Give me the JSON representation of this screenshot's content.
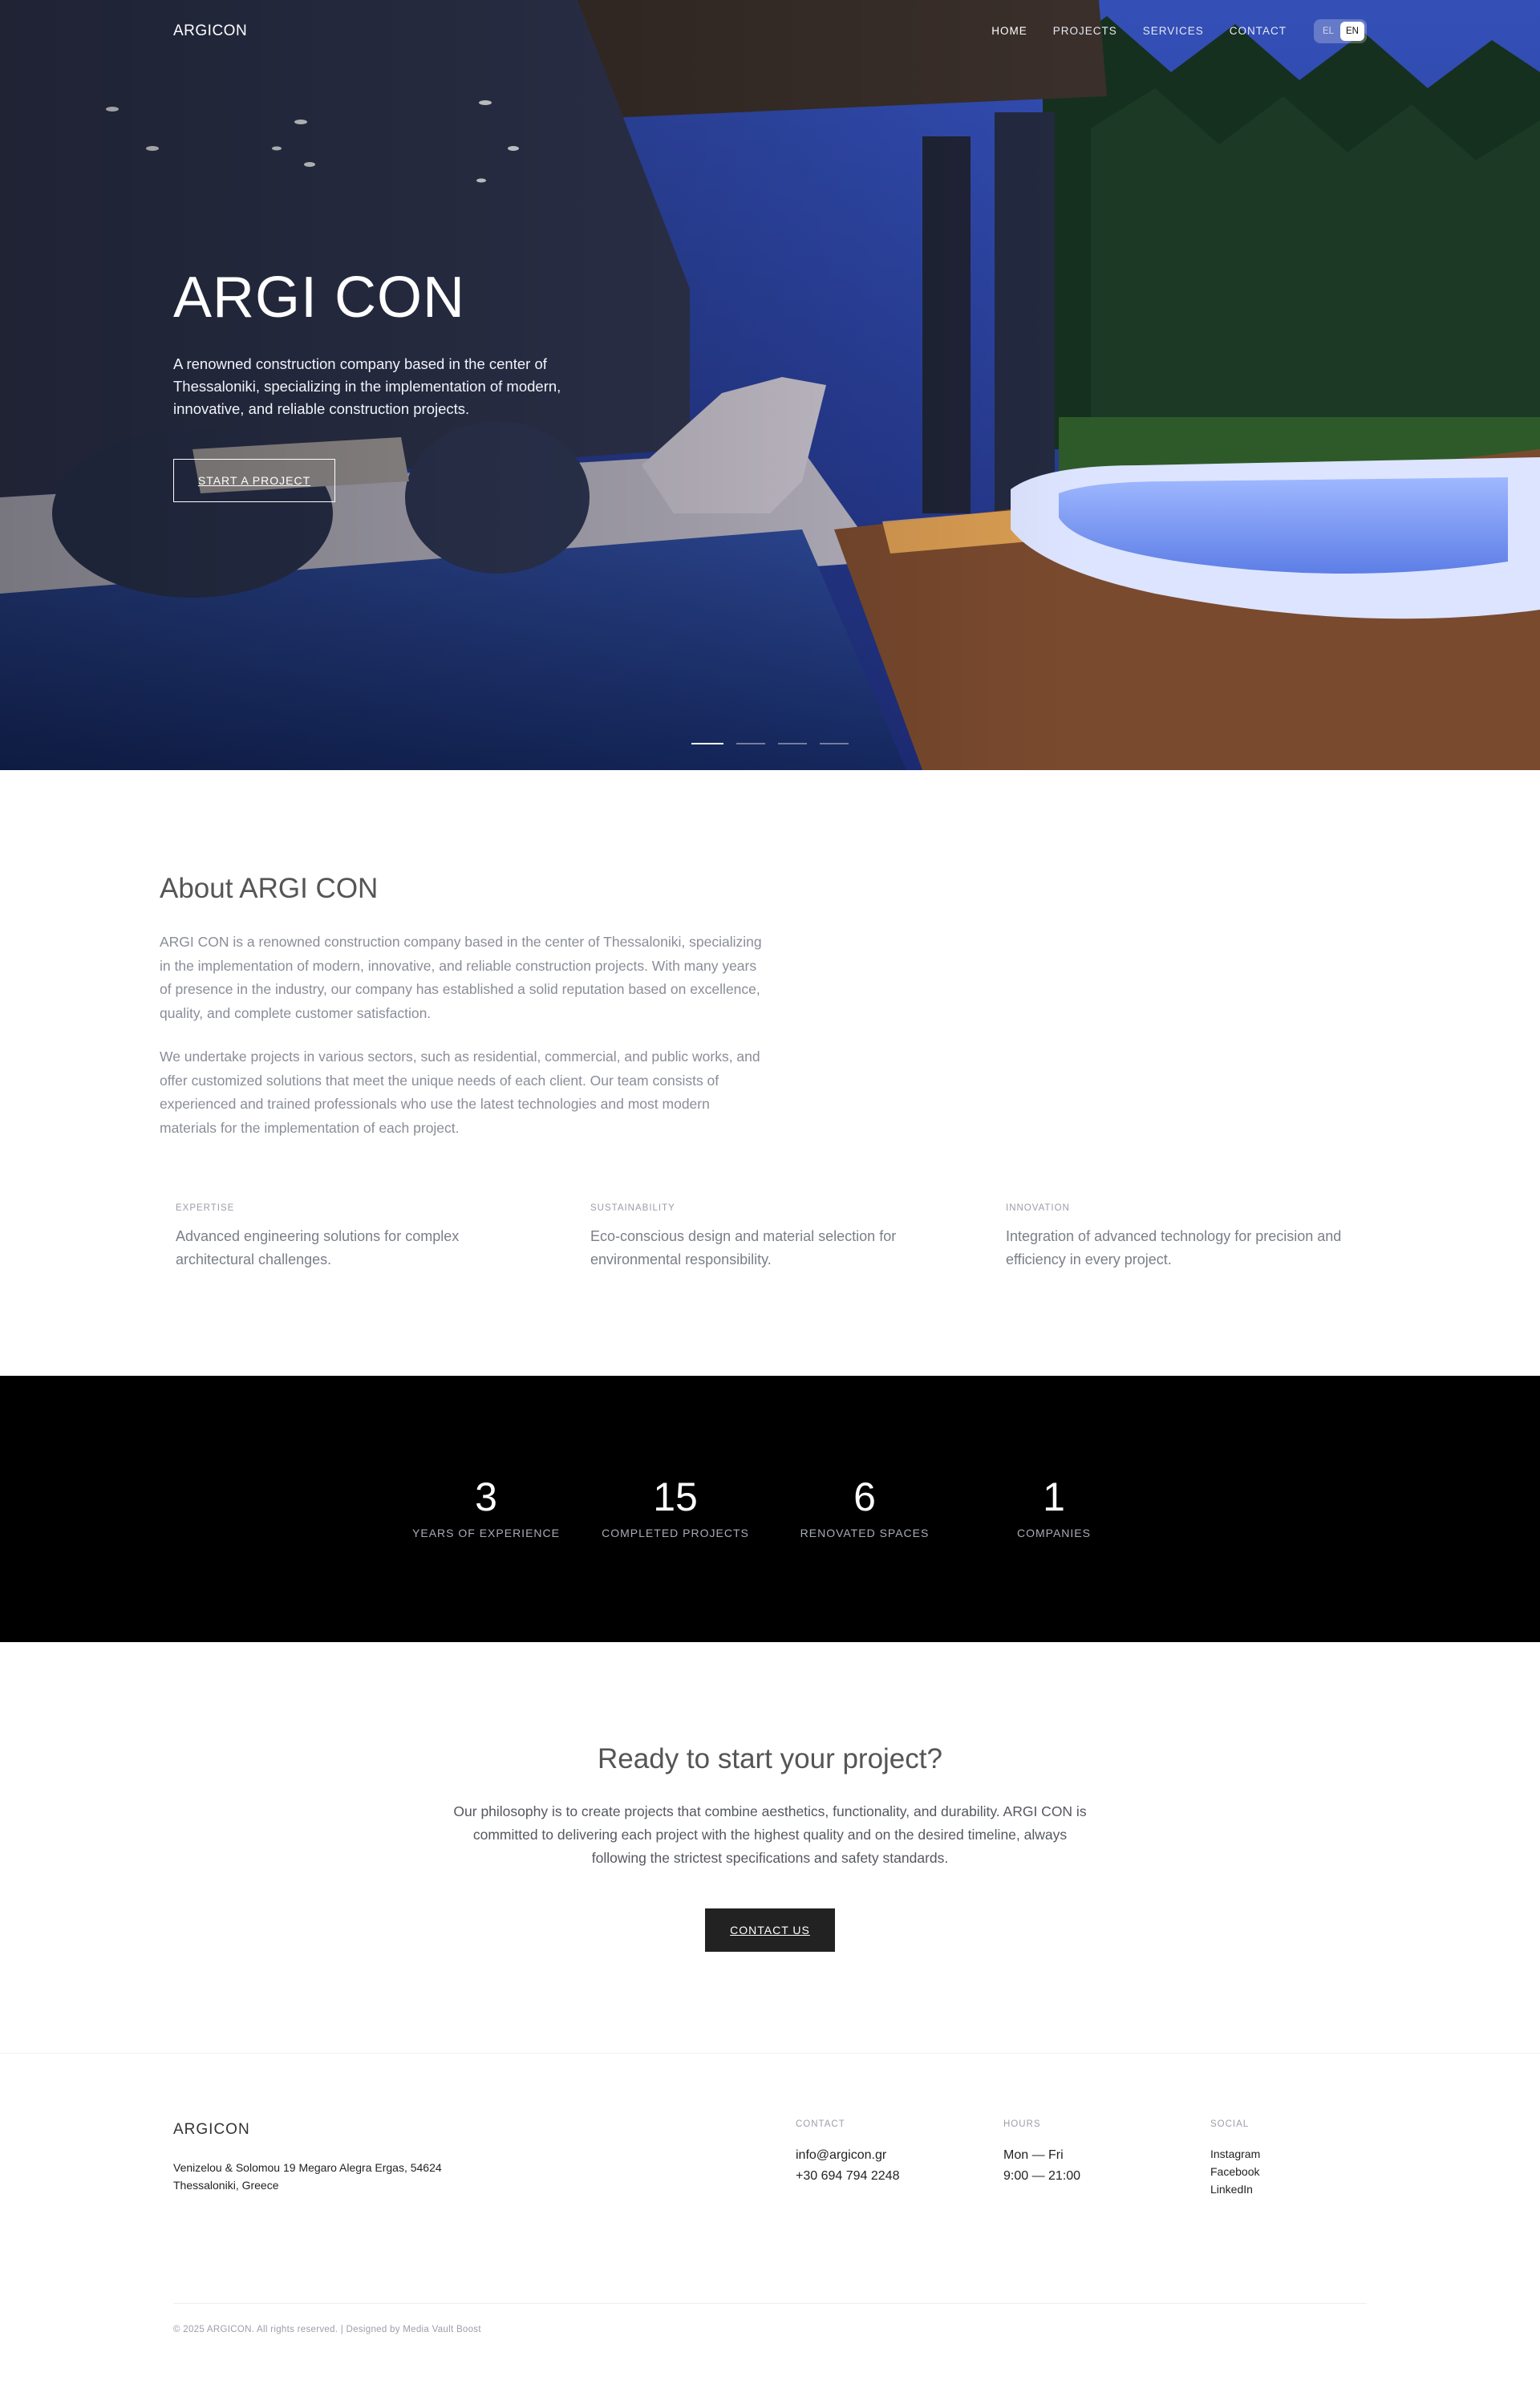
{
  "colors": {
    "hero_sky": "#2b3f9a",
    "stats_background": "#000000",
    "cta_button": "#222222",
    "muted_text": "#8a8d98"
  },
  "nav": {
    "logo": "ARGICON",
    "links": [
      "HOME",
      "PROJECTS",
      "SERVICES",
      "CONTACT"
    ],
    "active": "HOME",
    "lang": [
      "EL",
      "EN"
    ],
    "lang_active": "EN"
  },
  "hero": {
    "title": "ARGI CON",
    "text": "A renowned construction company based in the center of Thessaloniki, specializing in the implementation of modern, innovative, and reliable construction projects.",
    "button": "START A PROJECT",
    "slides": 4,
    "active_slide": 1
  },
  "about": {
    "title": "About ARGI CON",
    "p1": "ARGI CON is a renowned construction company based in the center of Thessaloniki, specializing in the implementation of modern, innovative, and reliable construction projects. With many years of presence in the industry, our company has established a solid reputation based on excellence, quality, and complete customer satisfaction.",
    "p2": "We undertake projects in various sectors, such as residential, commercial, and public works, and offer customized solutions that meet the unique needs of each client. Our team consists of experienced and trained professionals who use the latest technologies and most modern materials for the implementation of each project.",
    "features": [
      {
        "caption": "EXPERTISE",
        "text": "Advanced engineering solutions for complex architectural challenges."
      },
      {
        "caption": "SUSTAINABILITY",
        "text": "Eco-conscious design and material selection for environmental responsibility."
      },
      {
        "caption": "INNOVATION",
        "text": "Integration of advanced technology for precision and efficiency in every project."
      }
    ]
  },
  "stats": [
    {
      "value": "3",
      "label": "YEARS OF EXPERIENCE"
    },
    {
      "value": "15",
      "label": "COMPLETED PROJECTS"
    },
    {
      "value": "6",
      "label": "RENOVATED SPACES"
    },
    {
      "value": "1",
      "label": "COMPANIES"
    }
  ],
  "cta": {
    "title": "Ready to start your project?",
    "text": "Our philosophy is to create projects that combine aesthetics, functionality, and durability. ARGI CON is committed to delivering each project with the highest quality and on the desired timeline, always following the strictest specifications and safety standards.",
    "button": "CONTACT US"
  },
  "footer": {
    "logo": "ARGICON",
    "address_line1": "Venizelou & Solomou 19 Megaro Alegra Ergas, 54624",
    "address_line2": "Thessaloniki, Greece",
    "contact_caption": "CONTACT",
    "email": "info@argicon.gr",
    "phone": "+30 694 794 2248",
    "hours_caption": "HOURS",
    "days": "Mon — Fri",
    "time": "9:00 — 21:00",
    "social_caption": "SOCIAL",
    "social": [
      "Instagram",
      "Facebook",
      "LinkedIn"
    ],
    "copyright": "© 2025 ARGICON. All rights reserved. | Designed by Media Vault Boost"
  }
}
